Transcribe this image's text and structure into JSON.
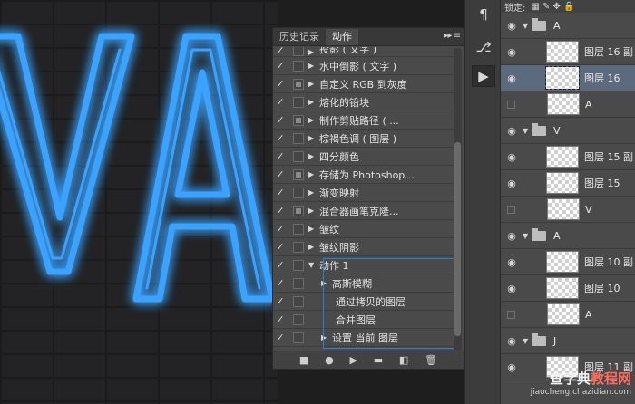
{
  "canvas": {
    "letters": "VA",
    "neon_color": "#3aa3ff"
  },
  "actions_panel": {
    "tabs": [
      "历史记录",
      "动作"
    ],
    "active_tab": "动作",
    "tab_tools": "▸▸ ≡",
    "rows": [
      {
        "label": "投影 ( 文字 )",
        "checked": true,
        "dialog": false,
        "expand": true,
        "level": 1,
        "cut": true
      },
      {
        "label": "水中倒影 ( 文字 )",
        "checked": true,
        "dialog": false,
        "expand": true,
        "level": 1
      },
      {
        "label": "自定义 RGB 到灰度",
        "checked": true,
        "dialog": true,
        "expand": true,
        "level": 1
      },
      {
        "label": "熔化的铅块",
        "checked": true,
        "dialog": false,
        "expand": true,
        "level": 1
      },
      {
        "label": "制作剪贴路径 ( ...",
        "checked": true,
        "dialog": true,
        "expand": true,
        "level": 1
      },
      {
        "label": "棕褐色调 ( 图层 )",
        "checked": true,
        "dialog": false,
        "expand": true,
        "level": 1
      },
      {
        "label": "四分颜色",
        "checked": true,
        "dialog": false,
        "expand": true,
        "level": 1
      },
      {
        "label": "存储为 Photoshop...",
        "checked": true,
        "dialog": true,
        "expand": true,
        "level": 1
      },
      {
        "label": "渐变映射",
        "checked": true,
        "dialog": false,
        "expand": true,
        "level": 1
      },
      {
        "label": "混合器画笔克隆...",
        "checked": true,
        "dialog": true,
        "expand": true,
        "level": 1
      },
      {
        "label": "皱纹",
        "checked": true,
        "dialog": false,
        "expand": true,
        "level": 1
      },
      {
        "label": "皱纹阴影",
        "checked": true,
        "dialog": false,
        "expand": true,
        "level": 1
      },
      {
        "label": "动作 1",
        "checked": true,
        "dialog": false,
        "expand": true,
        "open": true,
        "level": 1
      },
      {
        "label": "高斯模糊",
        "checked": true,
        "dialog": false,
        "expand": true,
        "level": 2
      },
      {
        "label": "通过拷贝的图层",
        "checked": true,
        "dialog": false,
        "expand": false,
        "level": 3
      },
      {
        "label": "合并图层",
        "checked": true,
        "dialog": false,
        "expand": false,
        "level": 3
      },
      {
        "label": "设置 当前 图层",
        "checked": true,
        "dialog": false,
        "expand": true,
        "level": 2
      }
    ],
    "bottom_icons": [
      "stop-icon",
      "record-icon",
      "play-icon",
      "new-set-icon",
      "new-action-icon",
      "delete-icon"
    ],
    "bottom_glyphs": [
      "■",
      "●",
      "▶",
      "▬",
      "◧",
      "🗑"
    ]
  },
  "icon_strip": {
    "buttons": [
      {
        "name": "paragraph-icon",
        "glyph": "¶"
      },
      {
        "name": "history-icon",
        "glyph": "⎇"
      },
      {
        "name": "actions-play-icon",
        "glyph": "▶"
      }
    ]
  },
  "layers_panel": {
    "lock_label": "锁定:",
    "lock_icons": "▦ ✎ ✥ 🔒",
    "rows": [
      {
        "type": "group",
        "name": "A",
        "visible": true
      },
      {
        "type": "layer",
        "name": "图层 16 副",
        "visible": true,
        "selected": false
      },
      {
        "type": "layer",
        "name": "图层 16",
        "visible": true,
        "selected": true
      },
      {
        "type": "layer",
        "name": "A",
        "visible": false,
        "selected": false
      },
      {
        "type": "group",
        "name": "V",
        "visible": true
      },
      {
        "type": "layer",
        "name": "图层 15 副",
        "visible": true,
        "selected": false
      },
      {
        "type": "layer",
        "name": "图层 15",
        "visible": true,
        "selected": false
      },
      {
        "type": "layer",
        "name": "V",
        "visible": false,
        "selected": false
      },
      {
        "type": "group",
        "name": "A",
        "visible": true
      },
      {
        "type": "layer",
        "name": "图层 10 副",
        "visible": true,
        "selected": false
      },
      {
        "type": "layer",
        "name": "图层 10",
        "visible": true,
        "selected": false
      },
      {
        "type": "layer",
        "name": "A",
        "visible": false,
        "selected": false
      },
      {
        "type": "group",
        "name": "J",
        "visible": true
      },
      {
        "type": "layer",
        "name": "图层 11 副",
        "visible": true,
        "selected": false
      }
    ]
  },
  "watermark": {
    "main_a": "查字典",
    "main_b": "教程网",
    "sub": "jiaocheng.chazidian.com"
  }
}
